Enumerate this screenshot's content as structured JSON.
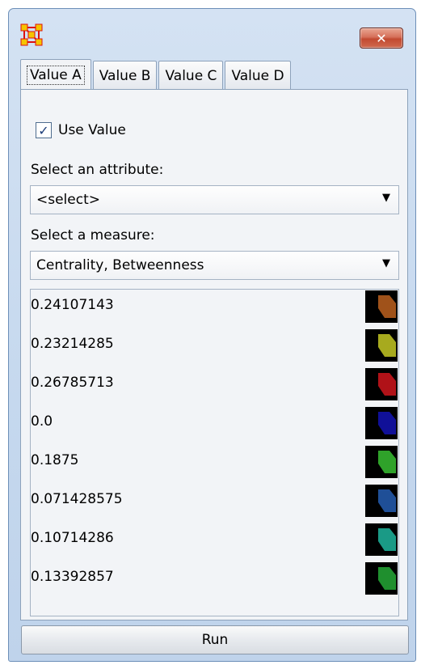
{
  "window": {
    "app_icon": "network-nodes-icon",
    "close_icon": "close-icon",
    "close_glyph": "✕"
  },
  "tabs": [
    {
      "label": "Value A",
      "active": true
    },
    {
      "label": "Value B",
      "active": false
    },
    {
      "label": "Value C",
      "active": false
    },
    {
      "label": "Value D",
      "active": false
    }
  ],
  "use_value": {
    "label": "Use Value",
    "checked": true
  },
  "attribute": {
    "label": "Select an attribute:",
    "selected": "<select>"
  },
  "measure": {
    "label": "Select a measure:",
    "selected": "Centrality, Betweenness"
  },
  "values": [
    {
      "value": "0.24107143",
      "color": "#a0521a"
    },
    {
      "value": "0.23214285",
      "color": "#a7aa1e"
    },
    {
      "value": "0.26785713",
      "color": "#b01218"
    },
    {
      "value": "0.0",
      "color": "#101098"
    },
    {
      "value": "0.1875",
      "color": "#2fa22a"
    },
    {
      "value": "0.071428575",
      "color": "#1f4f97"
    },
    {
      "value": "0.10714286",
      "color": "#1a9a86"
    },
    {
      "value": "0.13392857",
      "color": "#1f8f2e"
    }
  ],
  "run_label": "Run"
}
